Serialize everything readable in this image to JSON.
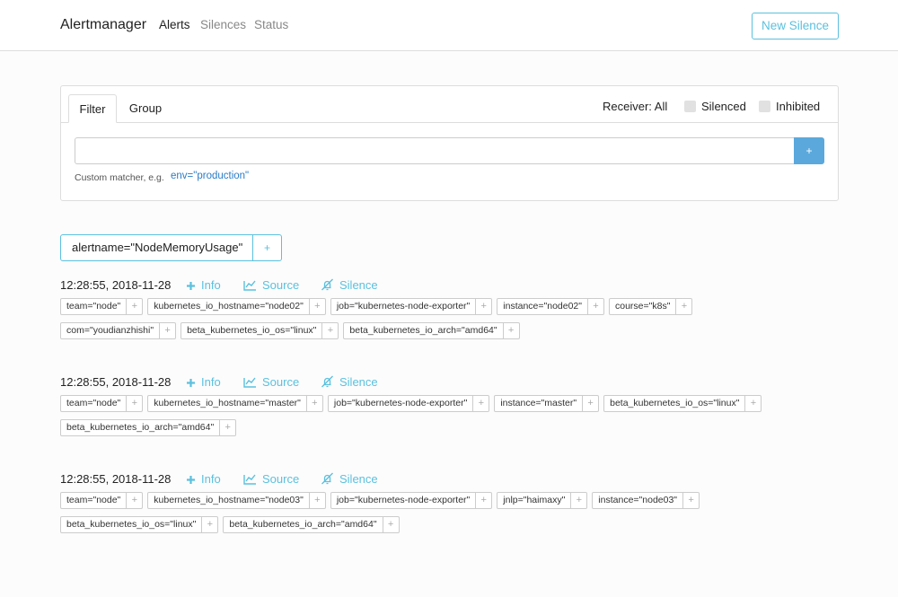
{
  "nav": {
    "brand": "Alertmanager",
    "links": [
      "Alerts",
      "Silences",
      "Status"
    ],
    "new_silence": "New Silence"
  },
  "filter": {
    "tabs": [
      "Filter",
      "Group"
    ],
    "receiver": "Receiver: All",
    "silenced": "Silenced",
    "inhibited": "Inhibited",
    "input_value": "",
    "add_button": "+",
    "hint": "Custom matcher, e.g.",
    "hint_example": "env=\"production\""
  },
  "group": {
    "label": "alertname=\"NodeMemoryUsage\"",
    "add": "+"
  },
  "actions": {
    "info": "Info",
    "source": "Source",
    "silence": "Silence"
  },
  "alerts": [
    {
      "time": "12:28:55, 2018-11-28",
      "rows": [
        [
          "team=\"node\"",
          "kubernetes_io_hostname=\"node02\"",
          "job=\"kubernetes-node-exporter\"",
          "instance=\"node02\"",
          "course=\"k8s\""
        ],
        [
          "com=\"youdianzhishi\"",
          "beta_kubernetes_io_os=\"linux\"",
          "beta_kubernetes_io_arch=\"amd64\""
        ]
      ]
    },
    {
      "time": "12:28:55, 2018-11-28",
      "rows": [
        [
          "team=\"node\"",
          "kubernetes_io_hostname=\"master\"",
          "job=\"kubernetes-node-exporter\"",
          "instance=\"master\"",
          "beta_kubernetes_io_os=\"linux\""
        ],
        [
          "beta_kubernetes_io_arch=\"amd64\""
        ]
      ]
    },
    {
      "time": "12:28:55, 2018-11-28",
      "rows": [
        [
          "team=\"node\"",
          "kubernetes_io_hostname=\"node03\"",
          "job=\"kubernetes-node-exporter\"",
          "jnlp=\"haimaxy\"",
          "instance=\"node03\""
        ],
        [
          "beta_kubernetes_io_os=\"linux\"",
          "beta_kubernetes_io_arch=\"amd64\""
        ]
      ]
    }
  ],
  "label_add": "+",
  "colors": {
    "accent": "#5bc0de",
    "primary_button": "#5ba9dc",
    "link": "#2a7cc7"
  }
}
